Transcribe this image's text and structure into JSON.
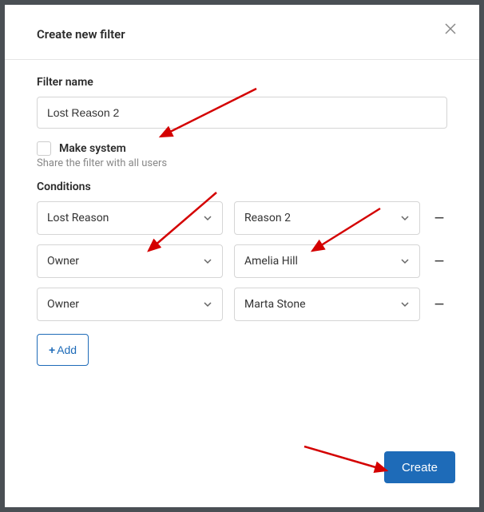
{
  "header": {
    "title": "Create new filter"
  },
  "filter_name": {
    "label": "Filter name",
    "value": "Lost Reason 2"
  },
  "make_system": {
    "label": "Make system",
    "hint": "Share the filter with all users"
  },
  "conditions": {
    "label": "Conditions",
    "rows": [
      {
        "field": "Lost Reason",
        "value": "Reason 2"
      },
      {
        "field": "Owner",
        "value": "Amelia Hill"
      },
      {
        "field": "Owner",
        "value": "Marta Stone"
      }
    ],
    "add_label": "Add"
  },
  "footer": {
    "create_label": "Create"
  }
}
